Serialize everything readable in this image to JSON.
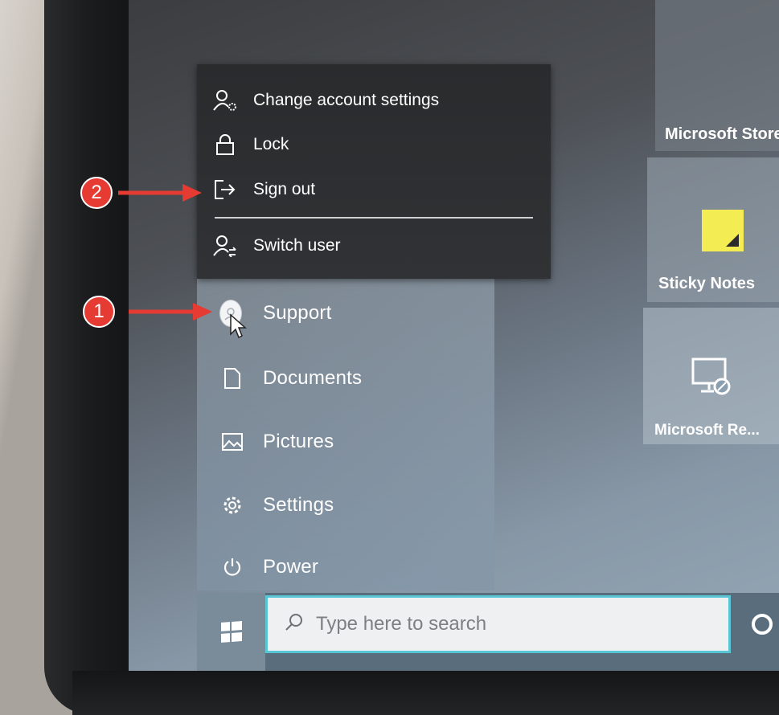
{
  "account_flyout": {
    "items": [
      {
        "label": "Change account settings",
        "icon": "account-settings-icon"
      },
      {
        "label": "Lock",
        "icon": "lock-icon"
      },
      {
        "label": "Sign out",
        "icon": "sign-out-icon"
      },
      {
        "label": "Switch user",
        "icon": "switch-user-icon"
      }
    ]
  },
  "start_menu": {
    "user": {
      "name": "Support",
      "icon": "user-avatar-icon"
    },
    "items": [
      {
        "label": "Documents",
        "icon": "document-icon"
      },
      {
        "label": "Pictures",
        "icon": "pictures-icon"
      },
      {
        "label": "Settings",
        "icon": "gear-icon"
      },
      {
        "label": "Power",
        "icon": "power-icon"
      }
    ]
  },
  "tiles": [
    {
      "label": "Microsoft Store"
    },
    {
      "label": "Sticky Notes"
    },
    {
      "label": "Microsoft Re..."
    }
  ],
  "taskbar": {
    "search_placeholder": "Type here to search"
  },
  "annotations": [
    {
      "number": "1"
    },
    {
      "number": "2"
    }
  ],
  "colors": {
    "accent_cyan": "#59c6d6",
    "sticky_yellow": "#f3ec52",
    "annotation_red": "#e53b33"
  }
}
